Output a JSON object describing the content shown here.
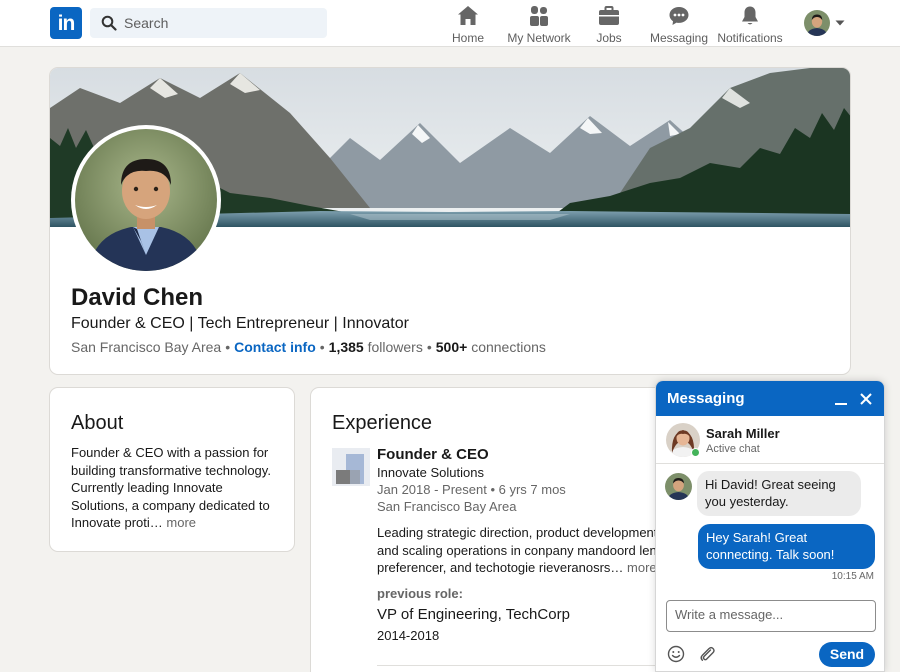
{
  "brand": {
    "logo_text": "in",
    "accent": "#0a66c2"
  },
  "search": {
    "placeholder": "Search"
  },
  "nav": {
    "items": [
      {
        "label": "Home",
        "icon": "home-icon"
      },
      {
        "label": "My Network",
        "icon": "network-icon"
      },
      {
        "label": "Jobs",
        "icon": "briefcase-icon"
      },
      {
        "label": "Messaging",
        "icon": "messaging-icon"
      },
      {
        "label": "Notifications",
        "icon": "bell-icon"
      }
    ]
  },
  "profile": {
    "name": "David Chen",
    "headline": "Founder & CEO | Tech Entrepreneur | Innovator",
    "location": "San Francisco Bay Area",
    "contact_info": "Contact info",
    "followers_count": "1,385",
    "followers_label": "followers",
    "connections_count": "500+",
    "connections_label": "connections"
  },
  "about": {
    "title": "About",
    "text": "Founder & CEO with a passion for building transformative technology. Currently leading Innovate Solutions, a company dedicated to Innovate proti…",
    "more": "more"
  },
  "experience": {
    "title": "Experience",
    "current": {
      "title": "Founder & CEO",
      "company": "Innovate Solutions",
      "dates": "Jan 2018 - Present • 6 yrs 7 mos",
      "location": "San Francisco Bay Area",
      "description": "Leading strategic direction, product development, and scaling operations in conpany mandoord lendi preferencer, and techotogie rieveranosrs…",
      "more": "more"
    },
    "previous_label": "previous role:",
    "previous": {
      "title": "VP of Engineering, TechCorp",
      "years": "2014-2018"
    }
  },
  "messaging": {
    "title": "Messaging",
    "contact_name": "Sarah Miller",
    "contact_status": "Active chat",
    "messages": [
      {
        "direction": "in",
        "text": "Hi David! Great seeing you yesterday."
      },
      {
        "direction": "out",
        "text": "Hey Sarah! Great connecting. Talk soon!"
      }
    ],
    "time": "10:15 AM",
    "input_placeholder": "Write a message...",
    "send_label": "Send"
  }
}
